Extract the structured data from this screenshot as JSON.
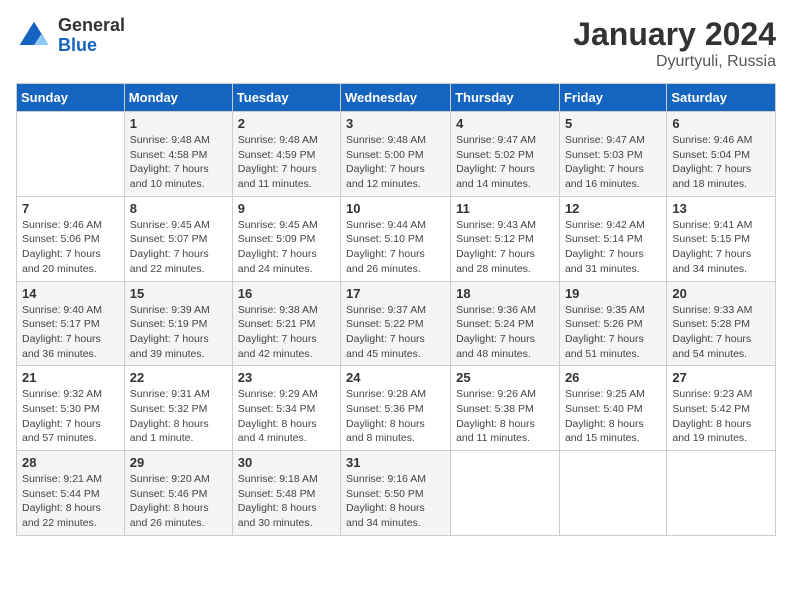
{
  "header": {
    "logo_general": "General",
    "logo_blue": "Blue",
    "month_title": "January 2024",
    "location": "Dyurtyuli, Russia"
  },
  "weekdays": [
    "Sunday",
    "Monday",
    "Tuesday",
    "Wednesday",
    "Thursday",
    "Friday",
    "Saturday"
  ],
  "weeks": [
    [
      {
        "day": "",
        "info": ""
      },
      {
        "day": "1",
        "info": "Sunrise: 9:48 AM\nSunset: 4:58 PM\nDaylight: 7 hours\nand 10 minutes."
      },
      {
        "day": "2",
        "info": "Sunrise: 9:48 AM\nSunset: 4:59 PM\nDaylight: 7 hours\nand 11 minutes."
      },
      {
        "day": "3",
        "info": "Sunrise: 9:48 AM\nSunset: 5:00 PM\nDaylight: 7 hours\nand 12 minutes."
      },
      {
        "day": "4",
        "info": "Sunrise: 9:47 AM\nSunset: 5:02 PM\nDaylight: 7 hours\nand 14 minutes."
      },
      {
        "day": "5",
        "info": "Sunrise: 9:47 AM\nSunset: 5:03 PM\nDaylight: 7 hours\nand 16 minutes."
      },
      {
        "day": "6",
        "info": "Sunrise: 9:46 AM\nSunset: 5:04 PM\nDaylight: 7 hours\nand 18 minutes."
      }
    ],
    [
      {
        "day": "7",
        "info": "Sunrise: 9:46 AM\nSunset: 5:06 PM\nDaylight: 7 hours\nand 20 minutes."
      },
      {
        "day": "8",
        "info": "Sunrise: 9:45 AM\nSunset: 5:07 PM\nDaylight: 7 hours\nand 22 minutes."
      },
      {
        "day": "9",
        "info": "Sunrise: 9:45 AM\nSunset: 5:09 PM\nDaylight: 7 hours\nand 24 minutes."
      },
      {
        "day": "10",
        "info": "Sunrise: 9:44 AM\nSunset: 5:10 PM\nDaylight: 7 hours\nand 26 minutes."
      },
      {
        "day": "11",
        "info": "Sunrise: 9:43 AM\nSunset: 5:12 PM\nDaylight: 7 hours\nand 28 minutes."
      },
      {
        "day": "12",
        "info": "Sunrise: 9:42 AM\nSunset: 5:14 PM\nDaylight: 7 hours\nand 31 minutes."
      },
      {
        "day": "13",
        "info": "Sunrise: 9:41 AM\nSunset: 5:15 PM\nDaylight: 7 hours\nand 34 minutes."
      }
    ],
    [
      {
        "day": "14",
        "info": "Sunrise: 9:40 AM\nSunset: 5:17 PM\nDaylight: 7 hours\nand 36 minutes."
      },
      {
        "day": "15",
        "info": "Sunrise: 9:39 AM\nSunset: 5:19 PM\nDaylight: 7 hours\nand 39 minutes."
      },
      {
        "day": "16",
        "info": "Sunrise: 9:38 AM\nSunset: 5:21 PM\nDaylight: 7 hours\nand 42 minutes."
      },
      {
        "day": "17",
        "info": "Sunrise: 9:37 AM\nSunset: 5:22 PM\nDaylight: 7 hours\nand 45 minutes."
      },
      {
        "day": "18",
        "info": "Sunrise: 9:36 AM\nSunset: 5:24 PM\nDaylight: 7 hours\nand 48 minutes."
      },
      {
        "day": "19",
        "info": "Sunrise: 9:35 AM\nSunset: 5:26 PM\nDaylight: 7 hours\nand 51 minutes."
      },
      {
        "day": "20",
        "info": "Sunrise: 9:33 AM\nSunset: 5:28 PM\nDaylight: 7 hours\nand 54 minutes."
      }
    ],
    [
      {
        "day": "21",
        "info": "Sunrise: 9:32 AM\nSunset: 5:30 PM\nDaylight: 7 hours\nand 57 minutes."
      },
      {
        "day": "22",
        "info": "Sunrise: 9:31 AM\nSunset: 5:32 PM\nDaylight: 8 hours\nand 1 minute."
      },
      {
        "day": "23",
        "info": "Sunrise: 9:29 AM\nSunset: 5:34 PM\nDaylight: 8 hours\nand 4 minutes."
      },
      {
        "day": "24",
        "info": "Sunrise: 9:28 AM\nSunset: 5:36 PM\nDaylight: 8 hours\nand 8 minutes."
      },
      {
        "day": "25",
        "info": "Sunrise: 9:26 AM\nSunset: 5:38 PM\nDaylight: 8 hours\nand 11 minutes."
      },
      {
        "day": "26",
        "info": "Sunrise: 9:25 AM\nSunset: 5:40 PM\nDaylight: 8 hours\nand 15 minutes."
      },
      {
        "day": "27",
        "info": "Sunrise: 9:23 AM\nSunset: 5:42 PM\nDaylight: 8 hours\nand 19 minutes."
      }
    ],
    [
      {
        "day": "28",
        "info": "Sunrise: 9:21 AM\nSunset: 5:44 PM\nDaylight: 8 hours\nand 22 minutes."
      },
      {
        "day": "29",
        "info": "Sunrise: 9:20 AM\nSunset: 5:46 PM\nDaylight: 8 hours\nand 26 minutes."
      },
      {
        "day": "30",
        "info": "Sunrise: 9:18 AM\nSunset: 5:48 PM\nDaylight: 8 hours\nand 30 minutes."
      },
      {
        "day": "31",
        "info": "Sunrise: 9:16 AM\nSunset: 5:50 PM\nDaylight: 8 hours\nand 34 minutes."
      },
      {
        "day": "",
        "info": ""
      },
      {
        "day": "",
        "info": ""
      },
      {
        "day": "",
        "info": ""
      }
    ]
  ]
}
